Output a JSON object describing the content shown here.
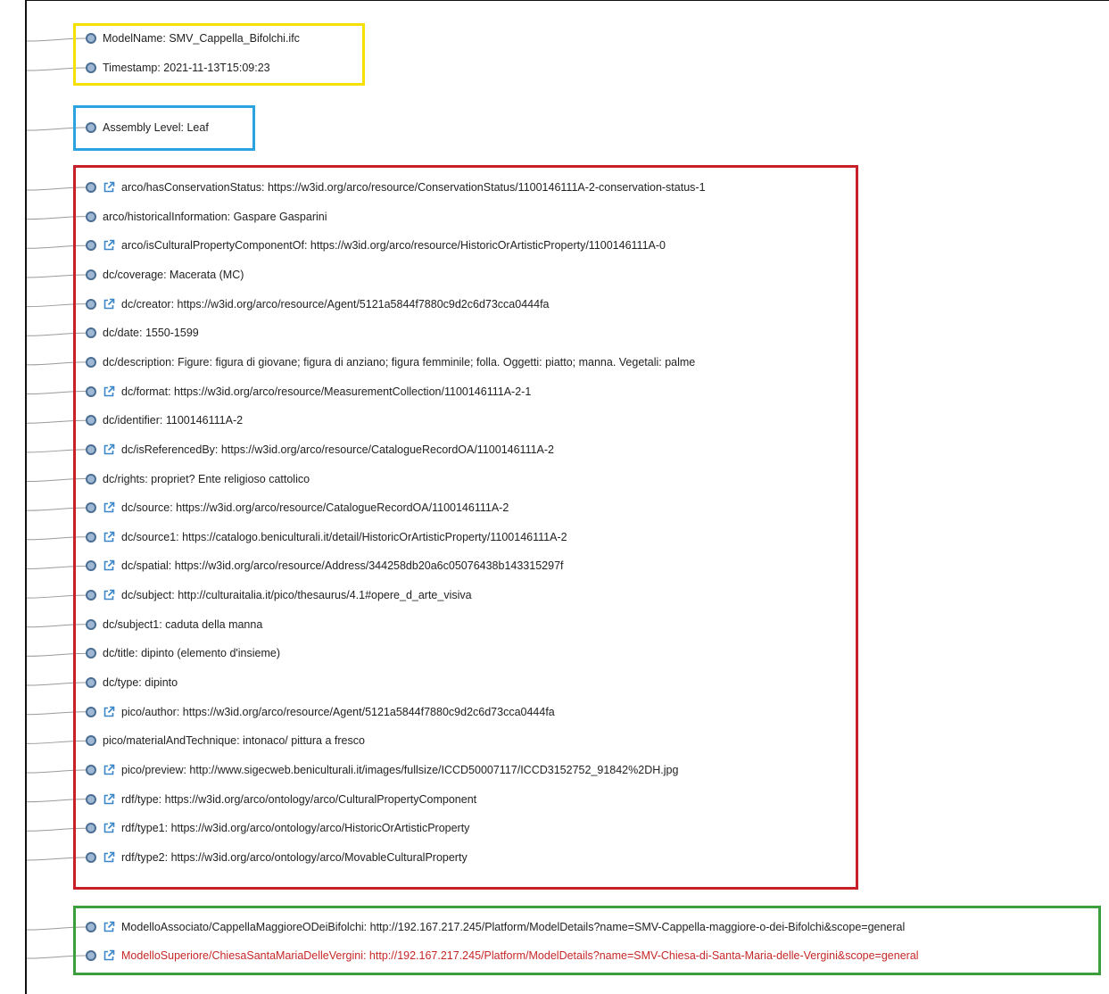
{
  "colors": {
    "node_fill": "#9fb7d3",
    "node_stroke": "#4a6d93",
    "link_icon": "#3a86c8",
    "highlight_text": "#c62828",
    "model_group": "#f5e000",
    "assembly_group": "#2aa3e0",
    "metadata_group": "#c8202a",
    "related_group": "#3c9e3c"
  },
  "groups": {
    "model": {
      "color_name": "yellow",
      "nodes": [
        {
          "label": "ModelName: SMV_Cappella_Bifolchi.ifc",
          "link": false
        },
        {
          "label": "Timestamp: 2021-11-13T15:09:23",
          "link": false
        }
      ]
    },
    "assembly": {
      "color_name": "blue",
      "nodes": [
        {
          "label": "Assembly Level: Leaf",
          "link": false
        }
      ]
    },
    "metadata": {
      "color_name": "red",
      "nodes": [
        {
          "label": "arco/hasConservationStatus: https://w3id.org/arco/resource/ConservationStatus/1100146111A-2-conservation-status-1",
          "link": true
        },
        {
          "label": "arco/historicalInformation: Gaspare Gasparini",
          "link": false
        },
        {
          "label": "arco/isCulturalPropertyComponentOf: https://w3id.org/arco/resource/HistoricOrArtisticProperty/1100146111A-0",
          "link": true
        },
        {
          "label": "dc/coverage: Macerata (MC)",
          "link": false
        },
        {
          "label": "dc/creator: https://w3id.org/arco/resource/Agent/5121a5844f7880c9d2c6d73cca0444fa",
          "link": true
        },
        {
          "label": "dc/date: 1550-1599",
          "link": false
        },
        {
          "label": "dc/description: Figure: figura di giovane; figura di anziano; figura femminile; folla. Oggetti: piatto; manna. Vegetali: palme",
          "link": false
        },
        {
          "label": "dc/format: https://w3id.org/arco/resource/MeasurementCollection/1100146111A-2-1",
          "link": true
        },
        {
          "label": "dc/identifier: 1100146111A-2",
          "link": false
        },
        {
          "label": "dc/isReferencedBy: https://w3id.org/arco/resource/CatalogueRecordOA/1100146111A-2",
          "link": true
        },
        {
          "label": "dc/rights: propriet? Ente religioso cattolico",
          "link": false
        },
        {
          "label": "dc/source: https://w3id.org/arco/resource/CatalogueRecordOA/1100146111A-2",
          "link": true
        },
        {
          "label": "dc/source1: https://catalogo.beniculturali.it/detail/HistoricOrArtisticProperty/1100146111A-2",
          "link": true
        },
        {
          "label": "dc/spatial: https://w3id.org/arco/resource/Address/344258db20a6c05076438b143315297f",
          "link": true
        },
        {
          "label": "dc/subject: http://culturaitalia.it/pico/thesaurus/4.1#opere_d_arte_visiva",
          "link": true
        },
        {
          "label": "dc/subject1: caduta della manna",
          "link": false
        },
        {
          "label": "dc/title: dipinto (elemento d'insieme)",
          "link": false
        },
        {
          "label": "dc/type: dipinto",
          "link": false
        },
        {
          "label": "pico/author: https://w3id.org/arco/resource/Agent/5121a5844f7880c9d2c6d73cca0444fa",
          "link": true
        },
        {
          "label": "pico/materialAndTechnique: intonaco/ pittura a fresco",
          "link": false
        },
        {
          "label": "pico/preview: http://www.sigecweb.beniculturali.it/images/fullsize/ICCD50007117/ICCD3152752_91842%2DH.jpg",
          "link": true
        },
        {
          "label": "rdf/type: https://w3id.org/arco/ontology/arco/CulturalPropertyComponent",
          "link": true
        },
        {
          "label": "rdf/type1: https://w3id.org/arco/ontology/arco/HistoricOrArtisticProperty",
          "link": true
        },
        {
          "label": "rdf/type2: https://w3id.org/arco/ontology/arco/MovableCulturalProperty",
          "link": true
        }
      ]
    },
    "related": {
      "color_name": "green",
      "nodes": [
        {
          "label": "ModelloAssociato/CappellaMaggioreODeiBifolchi: http://192.167.217.245/Platform/ModelDetails?name=SMV-Cappella-maggiore-o-dei-Bifolchi&scope=general",
          "link": true,
          "highlight": false
        },
        {
          "label": "ModelloSuperiore/ChiesaSantaMariaDelleVergini: http://192.167.217.245/Platform/ModelDetails?name=SMV-Chiesa-di-Santa-Maria-delle-Vergini&scope=general",
          "link": true,
          "highlight": true
        }
      ]
    }
  }
}
